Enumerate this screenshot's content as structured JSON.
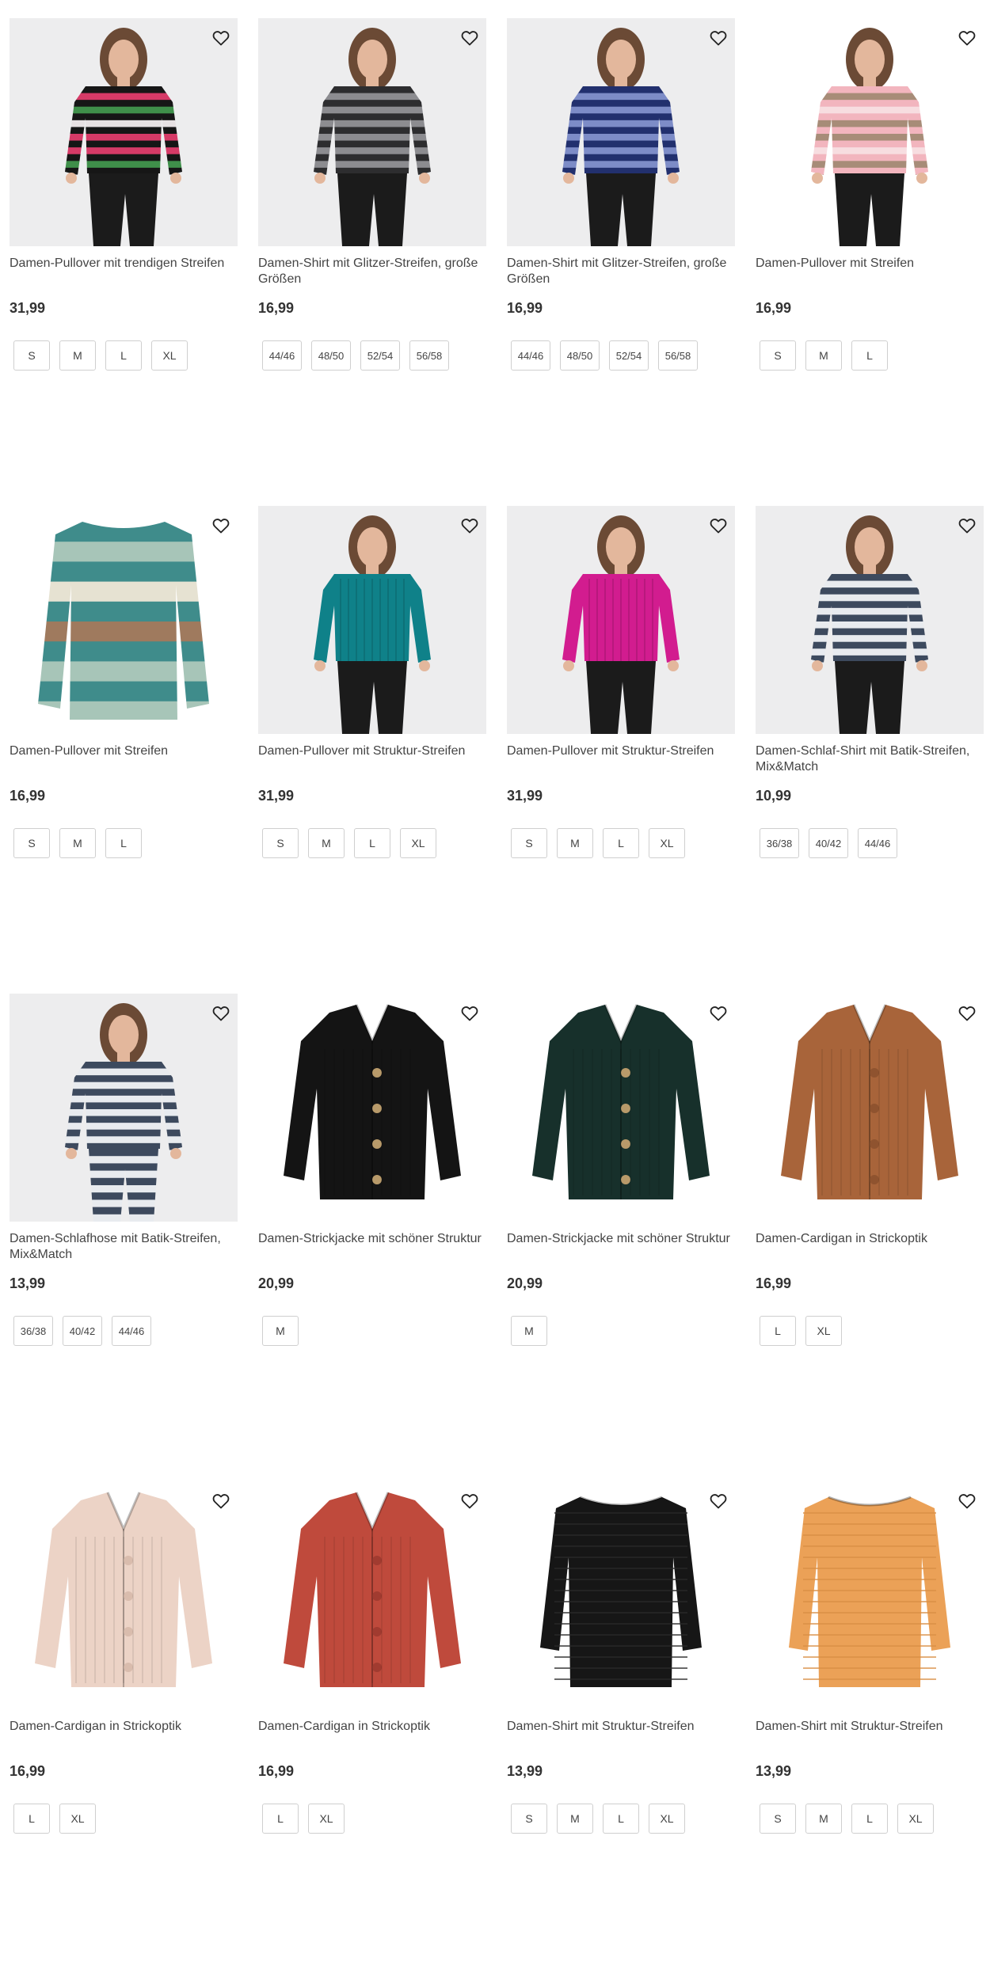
{
  "products": [
    {
      "title": "Damen-Pullover mit trendigen Streifen",
      "price": "31,99",
      "sizes": [
        "S",
        "M",
        "L",
        "XL"
      ],
      "image": "woman-black-multistripe-sweater",
      "bg": "gray",
      "colors": {
        "main": "#161616",
        "stripe1": "#d63a67",
        "stripe2": "#3f8f4a",
        "stripe3": "#e7e1e3"
      }
    },
    {
      "title": "Damen-Shirt mit Glitzer-Streifen, große Größen",
      "price": "16,99",
      "sizes": [
        "44/46",
        "48/50",
        "52/54",
        "56/58"
      ],
      "image": "woman-gray-glitter-stripe-shirt",
      "bg": "gray",
      "colors": {
        "main": "#2d2d2f",
        "stripe1": "#8c8c90"
      }
    },
    {
      "title": "Damen-Shirt mit Glitzer-Streifen, große Größen",
      "price": "16,99",
      "sizes": [
        "44/46",
        "48/50",
        "52/54",
        "56/58"
      ],
      "image": "woman-blue-glitter-stripe-shirt",
      "bg": "gray",
      "colors": {
        "main": "#22306e",
        "stripe1": "#7d8cc7"
      }
    },
    {
      "title": "Damen-Pullover mit Streifen",
      "price": "16,99",
      "sizes": [
        "S",
        "M",
        "L"
      ],
      "image": "woman-pink-stripe-sweater",
      "bg": "white",
      "colors": {
        "main": "#f2b5be",
        "stripe1": "#a78c78",
        "stripe2": "#f7dde0"
      }
    },
    {
      "title": "Damen-Pullover mit Streifen",
      "price": "16,99",
      "sizes": [
        "S",
        "M",
        "L"
      ],
      "image": "teal-stripe-sweater",
      "bg": "white",
      "colors": {
        "main": "#3f8c8b",
        "stripe1": "#a7c5b8",
        "stripe2": "#e6e2d2",
        "stripe3": "#9f7a5e"
      }
    },
    {
      "title": "Damen-Pullover mit Struktur-Streifen",
      "price": "31,99",
      "sizes": [
        "S",
        "M",
        "L",
        "XL"
      ],
      "image": "woman-teal-ribbed-sweater",
      "bg": "gray",
      "colors": {
        "main": "#0f8189"
      }
    },
    {
      "title": "Damen-Pullover mit Struktur-Streifen",
      "price": "31,99",
      "sizes": [
        "S",
        "M",
        "L",
        "XL"
      ],
      "image": "woman-magenta-ribbed-sweater",
      "bg": "gray",
      "colors": {
        "main": "#d21c8f"
      }
    },
    {
      "title": "Damen-Schlaf-Shirt mit Batik-Streifen, Mix&Match",
      "price": "10,99",
      "sizes": [
        "36/38",
        "40/42",
        "44/46"
      ],
      "image": "woman-batik-sleep-shirt",
      "bg": "gray",
      "colors": {
        "main": "#3d4a5e",
        "stripe1": "#e8ebef"
      }
    },
    {
      "title": "Damen-Schlafhose mit Batik-Streifen, Mix&Match",
      "price": "13,99",
      "sizes": [
        "36/38",
        "40/42",
        "44/46"
      ],
      "image": "woman-batik-sleep-pants",
      "bg": "gray",
      "colors": {
        "main": "#3d4a5e",
        "stripe1": "#e8ebef"
      }
    },
    {
      "title": "Damen-Strickjacke mit schöner Struktur",
      "price": "20,99",
      "sizes": [
        "M"
      ],
      "image": "black-cardigan",
      "bg": "white",
      "colors": {
        "main": "#141414",
        "stripe1": "#b89a6a"
      }
    },
    {
      "title": "Damen-Strickjacke mit schöner Struktur",
      "price": "20,99",
      "sizes": [
        "M"
      ],
      "image": "dark-green-cardigan",
      "bg": "white",
      "colors": {
        "main": "#17302b",
        "stripe1": "#b89a6a"
      }
    },
    {
      "title": "Damen-Cardigan in Strickoptik",
      "price": "16,99",
      "sizes": [
        "L",
        "XL"
      ],
      "image": "brown-cardigan",
      "bg": "white",
      "colors": {
        "main": "#a8643a",
        "stripe1": "#8f532f"
      }
    },
    {
      "title": "Damen-Cardigan in Strickoptik",
      "price": "16,99",
      "sizes": [
        "L",
        "XL"
      ],
      "image": "beige-cardigan",
      "bg": "white",
      "colors": {
        "main": "#ecd3c6",
        "stripe1": "#d9bcad"
      }
    },
    {
      "title": "Damen-Cardigan in Strickoptik",
      "price": "16,99",
      "sizes": [
        "L",
        "XL"
      ],
      "image": "red-cardigan",
      "bg": "white",
      "colors": {
        "main": "#bf4a3c",
        "stripe1": "#a13b30"
      }
    },
    {
      "title": "Damen-Shirt mit Struktur-Streifen",
      "price": "13,99",
      "sizes": [
        "S",
        "M",
        "L",
        "XL"
      ],
      "image": "black-structure-shirt",
      "bg": "white",
      "colors": {
        "main": "#161616",
        "stripe1": "#2a2a2a"
      }
    },
    {
      "title": "Damen-Shirt mit Struktur-Streifen",
      "price": "13,99",
      "sizes": [
        "S",
        "M",
        "L",
        "XL"
      ],
      "image": "orange-structure-shirt",
      "bg": "white",
      "colors": {
        "main": "#eba157",
        "stripe1": "#d98e45"
      }
    }
  ],
  "icons": {
    "wishlist": "heart-outline-icon"
  }
}
